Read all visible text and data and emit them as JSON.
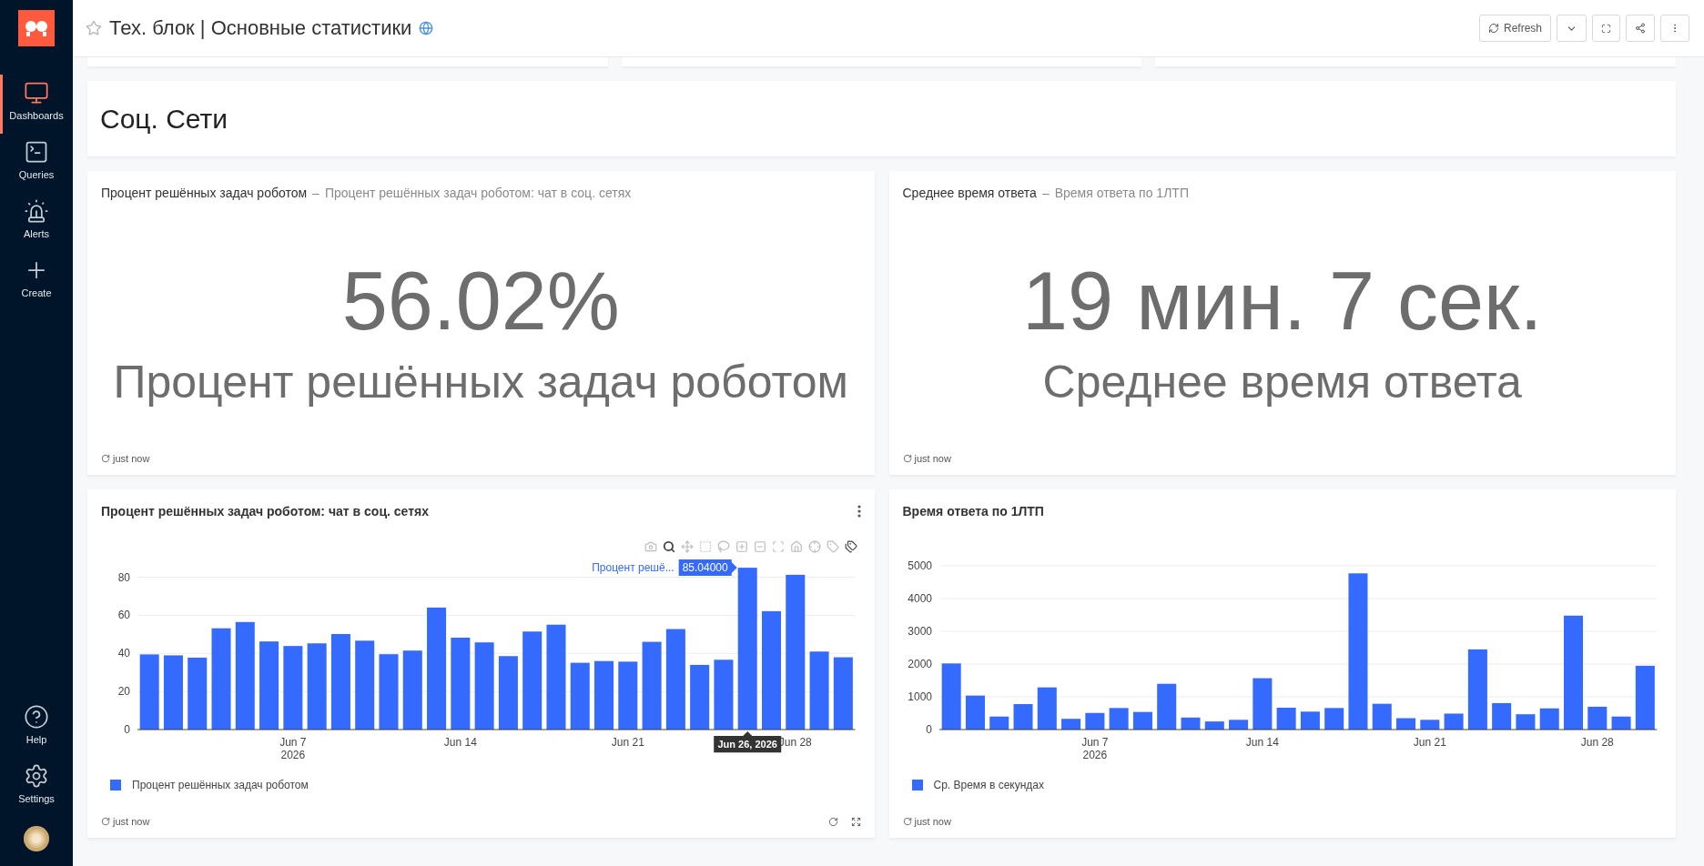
{
  "header": {
    "title": "Тех. блок | Основные статистики",
    "favorite": false,
    "published": true,
    "buttons": [
      {
        "kind": "refresh",
        "label": "Refresh"
      },
      {
        "kind": "dropdown"
      },
      {
        "kind": "fullscreen"
      },
      {
        "kind": "share"
      },
      {
        "kind": "more"
      }
    ]
  },
  "sidebar": {
    "items": [
      {
        "kind": "dashboards",
        "label": "Dashboards",
        "selected": true
      },
      {
        "kind": "queries",
        "label": "Queries",
        "selected": false
      },
      {
        "kind": "alerts",
        "label": "Alerts",
        "selected": false
      },
      {
        "kind": "create",
        "label": "Create",
        "selected": false
      }
    ],
    "bottom_items": [
      {
        "kind": "help",
        "label": "Help"
      },
      {
        "kind": "settings",
        "label": "Settings"
      }
    ]
  },
  "section": {
    "title": "Соц. Сети"
  },
  "counters": [
    {
      "title": "Процент решённых задач роботом",
      "separator": "–",
      "subtitle": "Процент решённых задач роботом: чат в соц. сетях",
      "value": "56.02%",
      "label": "Процент решённых задач роботом",
      "updated": "just now"
    },
    {
      "title": "Среднее время ответа",
      "separator": "–",
      "subtitle": "Время ответа по 1ЛТП",
      "value": "19 мин. 7 сек.",
      "label": "Среднее время ответа",
      "updated": "just now"
    }
  ],
  "charts": [
    {
      "title": "Процент решённых задач роботом: чат в соц. сетях",
      "hovered": true,
      "updated": "just now",
      "hover": {
        "series_label": "Процент решё...",
        "date": "Jun 26, 2026"
      },
      "chart_data": {
        "type": "bar",
        "x": [
          "2026-06-01",
          "2026-06-02",
          "2026-06-03",
          "2026-06-04",
          "2026-06-05",
          "2026-06-06",
          "2026-06-07",
          "2026-06-08",
          "2026-06-09",
          "2026-06-10",
          "2026-06-11",
          "2026-06-12",
          "2026-06-13",
          "2026-06-14",
          "2026-06-15",
          "2026-06-16",
          "2026-06-17",
          "2026-06-18",
          "2026-06-19",
          "2026-06-20",
          "2026-06-21",
          "2026-06-22",
          "2026-06-23",
          "2026-06-24",
          "2026-06-25",
          "2026-06-26",
          "2026-06-27",
          "2026-06-28",
          "2026-06-29",
          "2026-06-30"
        ],
        "series": [
          {
            "name": "Процент решённых задач роботом",
            "color": "#356aff",
            "values": [
              39.5,
              39,
              37.8,
              53.2,
              56.5,
              46.3,
              43.9,
              45.3,
              50.2,
              46.7,
              39.6,
              41.5,
              64.1,
              48.3,
              45.8,
              38.6,
              51.5,
              55.1,
              35.1,
              36,
              35.7,
              46.1,
              52.8,
              34,
              36.7,
              85,
              62.2,
              81.3,
              41,
              38
            ]
          }
        ],
        "annotations": [
          {
            "x": "2026-06-26",
            "y": 85,
            "text": "85.04000"
          }
        ],
        "grid": true,
        "xlim": [
          "2026-05-31T12:00:00Z",
          "2026-06-30T12:00:00Z"
        ],
        "ylim": [
          0,
          86
        ],
        "yticks": [
          0,
          20,
          40,
          60,
          80
        ],
        "xticks": [
          {
            "value": "2026-06-07",
            "label": "Jun 7\n2026"
          },
          {
            "value": "2026-06-14",
            "label": "Jun 14"
          },
          {
            "value": "2026-06-21",
            "label": "Jun 21"
          },
          {
            "value": "2026-06-28",
            "label": "Jun 28"
          }
        ]
      }
    },
    {
      "title": "Время ответа по 1ЛТП",
      "hovered": false,
      "updated": "just now",
      "chart_data": {
        "type": "bar",
        "x": [
          "2026-06-01",
          "2026-06-02",
          "2026-06-03",
          "2026-06-04",
          "2026-06-05",
          "2026-06-06",
          "2026-06-07",
          "2026-06-08",
          "2026-06-09",
          "2026-06-10",
          "2026-06-11",
          "2026-06-12",
          "2026-06-13",
          "2026-06-14",
          "2026-06-15",
          "2026-06-16",
          "2026-06-17",
          "2026-06-18",
          "2026-06-19",
          "2026-06-20",
          "2026-06-21",
          "2026-06-22",
          "2026-06-23",
          "2026-06-24",
          "2026-06-25",
          "2026-06-26",
          "2026-06-27",
          "2026-06-28",
          "2026-06-29",
          "2026-06-30"
        ],
        "series": [
          {
            "name": "Ср. Время в секундах",
            "color": "#356aff",
            "values": [
              2020,
              1040,
              400,
              780,
              1290,
              330,
              510,
              660,
              540,
              1400,
              370,
              250,
              300,
              1570,
              670,
              550,
              660,
              4770,
              790,
              350,
              300,
              490,
              2450,
              810,
              470,
              650,
              3480,
              700,
              400,
              1950
            ]
          }
        ],
        "grid": true,
        "xlim": [
          "2026-05-31T12:00:00Z",
          "2026-06-30T12:00:00Z"
        ],
        "ylim": [
          0,
          5000
        ],
        "yticks": [
          0,
          1000,
          2000,
          3000,
          4000,
          5000
        ],
        "xticks": [
          {
            "value": "2026-06-07",
            "label": "Jun 7\n2026"
          },
          {
            "value": "2026-06-14",
            "label": "Jun 14"
          },
          {
            "value": "2026-06-21",
            "label": "Jun 21"
          },
          {
            "value": "2026-06-28",
            "label": "Jun 28"
          }
        ]
      }
    }
  ]
}
